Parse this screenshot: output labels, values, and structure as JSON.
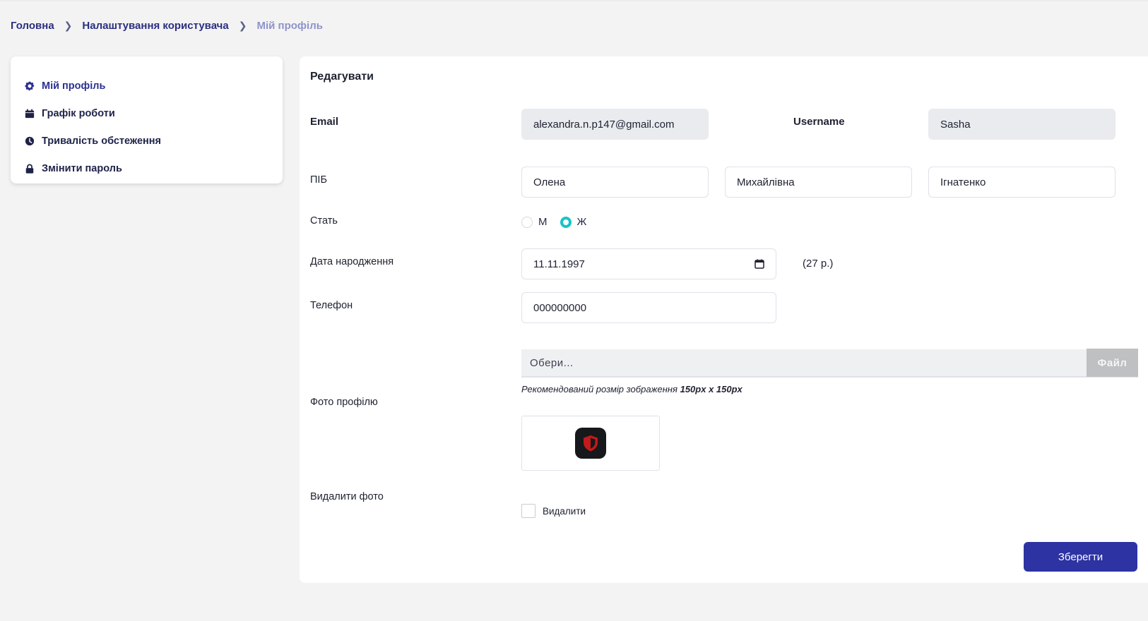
{
  "breadcrumb": {
    "items": [
      "Головна",
      "Налаштування користувача"
    ],
    "current": "Мій профіль"
  },
  "sidebar": {
    "items": [
      {
        "label": "Мій профіль",
        "icon": "gear-icon"
      },
      {
        "label": "Графік роботи",
        "icon": "calendar-icon"
      },
      {
        "label": "Тривалість обстеження",
        "icon": "clock-icon"
      },
      {
        "label": "Змінити пароль",
        "icon": "lock-icon"
      }
    ]
  },
  "form": {
    "title": "Редагувати",
    "email_label": "Email",
    "email_value": "alexandra.n.p147@gmail.com",
    "username_label": "Username",
    "username_value": "Sasha",
    "name_label": "ПІБ",
    "first_name": "Олена",
    "middle_name": "Михайлівна",
    "last_name": "Ігнатенко",
    "gender_label": "Стать",
    "gender_options": [
      "М",
      "Ж"
    ],
    "gender_selected": "Ж",
    "birthdate_label": "Дата народження",
    "birthdate_value": "11.11.1997",
    "age": "(27 р.)",
    "phone_label": "Телефон",
    "phone_value": "000000000",
    "file_placeholder": "Обери...",
    "file_button": "Файл",
    "hint_text": "Рекомендований розмір зображення ",
    "hint_size": "150px x 150px",
    "photo_label": "Фото профілю",
    "delete_photo_label": "Видалити фото",
    "delete_checkbox_label": "Видалити",
    "save_button": "Зберегти"
  },
  "colors": {
    "accent": "#2d33a2",
    "radio_selected": "#16c4c8",
    "breadcrumb_current": "#8e93c9"
  }
}
